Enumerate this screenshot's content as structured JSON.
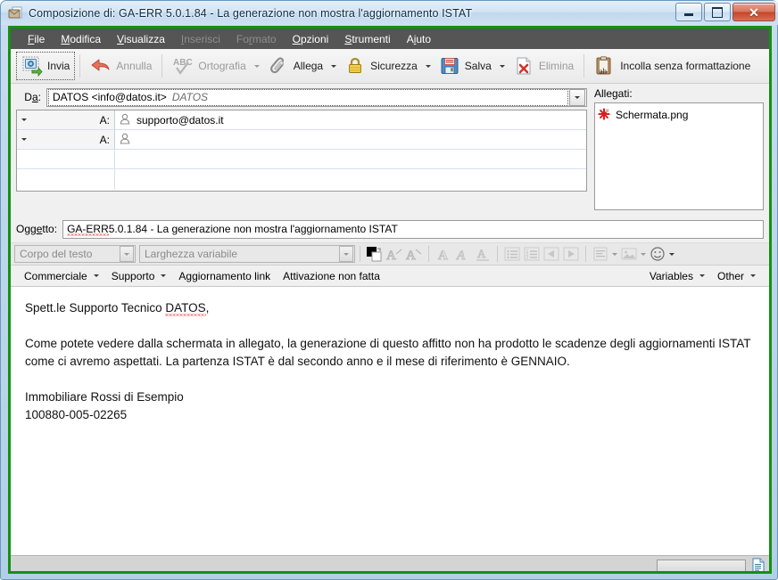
{
  "window": {
    "title": "Composizione di: GA-ERR 5.0.1.84 - La generazione non mostra l'aggiornamento ISTAT",
    "title_icon": "compose-mail-icon",
    "minimize_label": "Riduci a icona",
    "maximize_label": "Ingrandisci",
    "close_label": "Chiudi",
    "accent_border_color": "#12920f"
  },
  "menubar": {
    "items": [
      {
        "label": "File",
        "accel": "F",
        "disabled": false
      },
      {
        "label": "Modifica",
        "accel": "M",
        "disabled": false
      },
      {
        "label": "Visualizza",
        "accel": "V",
        "disabled": false
      },
      {
        "label": "Inserisci",
        "accel": "I",
        "disabled": true
      },
      {
        "label": "Formato",
        "accel": "r",
        "disabled": true
      },
      {
        "label": "Opzioni",
        "accel": "O",
        "disabled": false
      },
      {
        "label": "Strumenti",
        "accel": "S",
        "disabled": false
      },
      {
        "label": "Aiuto",
        "accel": "i",
        "disabled": false
      }
    ]
  },
  "toolbar": {
    "buttons": [
      {
        "label": "Invia",
        "icon": "send-mail-icon",
        "disabled": false,
        "focused": true,
        "has_dropdown": false
      },
      {
        "label": "Annulla",
        "icon": "undo-arrow-icon",
        "disabled": true,
        "focused": false,
        "has_dropdown": false
      },
      {
        "label": "Ortografia",
        "icon": "spellcheck-abc-icon",
        "disabled": true,
        "focused": false,
        "has_dropdown": true
      },
      {
        "label": "Allega",
        "icon": "paperclip-icon",
        "disabled": false,
        "focused": false,
        "has_dropdown": true
      },
      {
        "label": "Sicurezza",
        "icon": "padlock-icon",
        "disabled": false,
        "focused": false,
        "has_dropdown": true
      },
      {
        "label": "Salva",
        "icon": "floppy-disk-icon",
        "disabled": false,
        "focused": false,
        "has_dropdown": true
      },
      {
        "label": "Elimina",
        "icon": "delete-document-icon",
        "disabled": true,
        "focused": false,
        "has_dropdown": false
      },
      {
        "label": "Incolla senza formattazione",
        "icon": "paste-plain-text-icon",
        "disabled": false,
        "focused": false,
        "has_dropdown": false
      }
    ]
  },
  "headers": {
    "from_label": "Da:",
    "from_accel": "a",
    "from_value": "DATOS <info@datos.it>",
    "from_identity": "DATOS",
    "recipients": [
      {
        "type": "A:",
        "value": "supporto@datos.it",
        "has_contact_icon": true,
        "blank": false
      },
      {
        "type": "A:",
        "value": "",
        "has_contact_icon": true,
        "blank": false
      },
      {
        "type": "",
        "value": "",
        "has_contact_icon": false,
        "blank": true
      },
      {
        "type": "",
        "value": "",
        "has_contact_icon": false,
        "blank": true
      }
    ],
    "attachments_label": "Allegati:",
    "attachments": [
      {
        "name": "Schermata.png",
        "icon": "image-attachment-icon"
      }
    ]
  },
  "subject": {
    "label": "Oggetto:",
    "accel": "e",
    "misspelled_prefix": "GA-ERR",
    "value_rest": " 5.0.1.84 - La generazione non mostra l'aggiornamento ISTAT"
  },
  "format_toolbar": {
    "paragraph_style": "Corpo del testo",
    "font_family": "Larghezza variabile",
    "color_swatch_fg": "#000000",
    "color_swatch_bg": "#ffffff",
    "icons": [
      {
        "name": "text-color-icon",
        "title": "Colore testo",
        "disabled": false
      },
      {
        "name": "decrease-font-size-icon",
        "title": "Riduci dimensione",
        "disabled": true
      },
      {
        "name": "increase-font-size-icon",
        "title": "Aumenta dimensione",
        "disabled": true
      },
      {
        "name": "bold-icon",
        "title": "Grassetto",
        "disabled": true
      },
      {
        "name": "italic-icon",
        "title": "Corsivo",
        "disabled": true
      },
      {
        "name": "underline-icon",
        "title": "Sottolineato",
        "disabled": true
      },
      {
        "name": "bulleted-list-icon",
        "title": "Elenco puntato",
        "disabled": true
      },
      {
        "name": "numbered-list-icon",
        "title": "Elenco numerato",
        "disabled": true
      },
      {
        "name": "outdent-icon",
        "title": "Riduci rientro",
        "disabled": true
      },
      {
        "name": "indent-icon",
        "title": "Aumenta rientro",
        "disabled": true
      },
      {
        "name": "align-icon",
        "title": "Allineamento",
        "disabled": true,
        "has_dropdown": true
      },
      {
        "name": "insert-image-icon",
        "title": "Inserisci immagine",
        "disabled": true,
        "has_dropdown": true
      },
      {
        "name": "smiley-icon",
        "title": "Faccina",
        "disabled": false,
        "has_dropdown": true
      }
    ]
  },
  "snippet_bar": {
    "left_items": [
      {
        "label": "Commerciale",
        "has_dropdown": true
      },
      {
        "label": "Supporto",
        "has_dropdown": true
      },
      {
        "label": "Aggiornamento link",
        "has_dropdown": false
      },
      {
        "label": "Attivazione non fatta",
        "has_dropdown": false
      }
    ],
    "right_items": [
      {
        "label": "Variables",
        "has_dropdown": true
      },
      {
        "label": "Other",
        "has_dropdown": true
      }
    ]
  },
  "body": {
    "greeting_prefix": "Spett.le Supporto Tecnico ",
    "greeting_misspelled": "DATOS",
    "greeting_suffix": ",",
    "paragraph": "Come potete vedere dalla schermata in allegato, la generazione di questo affitto non ha prodotto le scadenze degli aggiornamenti ISTAT come ci avremo aspettati. La partenza ISTAT è dal secondo anno e il mese di riferimento è GENNAIO.",
    "signature_line1": "Immobiliare Rossi di Esempio",
    "signature_line2": "100880-005-02265"
  },
  "statusbar": {
    "message": "",
    "progress_percent": 0,
    "doc_icon": "document-status-icon"
  }
}
